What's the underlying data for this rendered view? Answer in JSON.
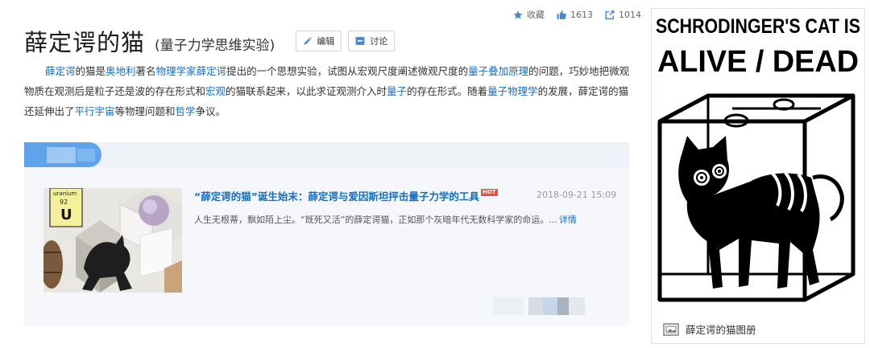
{
  "actions": {
    "favorite_label": "收藏",
    "like_count": "1613",
    "share_count": "1014"
  },
  "header": {
    "title": "薛定谔的猫",
    "subtitle": "(量子力学思维实验)",
    "edit_label": "编辑",
    "discuss_label": "讨论"
  },
  "summary": {
    "segments": [
      {
        "text": "薛定谔",
        "link": true
      },
      {
        "text": "的猫是",
        "link": false
      },
      {
        "text": "奥地利",
        "link": true
      },
      {
        "text": "著名",
        "link": false
      },
      {
        "text": "物理学家",
        "link": true
      },
      {
        "text": "薛定谔",
        "link": true
      },
      {
        "text": "提出的一个思想实验，试图从宏观尺度阐述微观尺度的",
        "link": false
      },
      {
        "text": "量子叠加原理",
        "link": true
      },
      {
        "text": "的问题，巧妙地把微观物质在观测后是粒子还是波的存在形式和",
        "link": false
      },
      {
        "text": "宏观",
        "link": true
      },
      {
        "text": "的猫联系起来，以此求证观测介入时",
        "link": false
      },
      {
        "text": "量子",
        "link": true
      },
      {
        "text": "的存在形式。随着",
        "link": false
      },
      {
        "text": "量子物理学",
        "link": true
      },
      {
        "text": "的发展，薛定谔的猫还延伸出了",
        "link": false
      },
      {
        "text": "平行宇宙",
        "link": true
      },
      {
        "text": "等物理问题和",
        "link": false
      },
      {
        "text": "哲学",
        "link": true
      },
      {
        "text": "争议。",
        "link": false
      }
    ]
  },
  "news": {
    "title": "“薛定谔的猫”诞生始末：薛定谔与爱因斯坦抨击量子力学的工具",
    "hot_badge": "HOT",
    "date": "2018-09-21 15:09",
    "description": "人生无根蒂，飘如陌上尘。“既死又活”的薛定谔猫，正如那个灰暗年代无数科学家的命运。...",
    "more_label": "详情",
    "thumb": {
      "element_name": "uranium",
      "atomic_number": "92",
      "symbol": "U"
    }
  },
  "album": {
    "poster_line1": "SCHRODINGER'S CAT IS",
    "poster_line2": "ALIVE / DEAD",
    "caption": "薛定谔的猫图册"
  },
  "colors": {
    "link": "#136ec2",
    "accent_blue": "#5ea3ec",
    "hot": "#f04c3e"
  }
}
